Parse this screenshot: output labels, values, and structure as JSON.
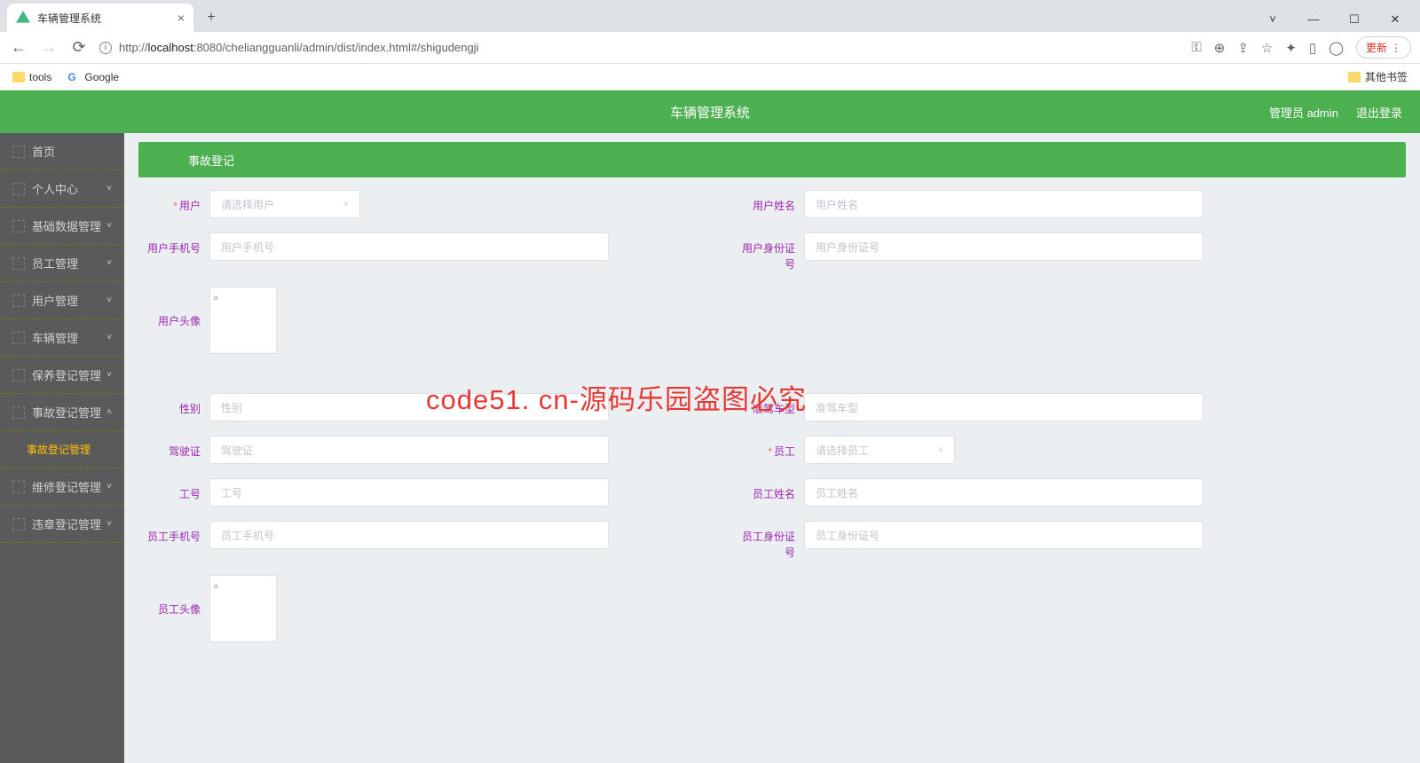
{
  "browser": {
    "tab_title": "车辆管理系统",
    "url_prefix": "http://",
    "url_host": "localhost",
    "url_path": ":8080/cheliangguanli/admin/dist/index.html#/shigudengji",
    "update_label": "更新",
    "bookmarks": {
      "tools": "tools",
      "google": "Google",
      "other": "其他书签"
    }
  },
  "header": {
    "title": "车辆管理系统",
    "admin": "管理员 admin",
    "logout": "退出登录"
  },
  "sidebar": {
    "items": [
      {
        "label": "首页",
        "chev": ""
      },
      {
        "label": "个人中心",
        "chev": "˅"
      },
      {
        "label": "基础数据管理",
        "chev": "˅"
      },
      {
        "label": "员工管理",
        "chev": "˅"
      },
      {
        "label": "用户管理",
        "chev": "˅"
      },
      {
        "label": "车辆管理",
        "chev": "˅"
      },
      {
        "label": "保养登记管理",
        "chev": "˅"
      },
      {
        "label": "事故登记管理",
        "chev": "˄"
      },
      {
        "label": "维修登记管理",
        "chev": "˅"
      },
      {
        "label": "违章登记管理",
        "chev": "˅"
      }
    ],
    "sub_item": "事故登记管理"
  },
  "panel": {
    "title": "事故登记"
  },
  "form": {
    "user": {
      "label": "用户",
      "placeholder": "请选择用户"
    },
    "user_name": {
      "label": "用户姓名",
      "placeholder": "用户姓名"
    },
    "user_phone": {
      "label": "用户手机号",
      "placeholder": "用户手机号"
    },
    "user_idcard": {
      "label": "用户身份证号",
      "placeholder": "用户身份证号"
    },
    "user_avatar": {
      "label": "用户头像"
    },
    "gender": {
      "label": "性别",
      "placeholder": "性别"
    },
    "car_type": {
      "label": "准驾车型",
      "placeholder": "准驾车型"
    },
    "license": {
      "label": "驾驶证",
      "placeholder": "驾驶证"
    },
    "staff": {
      "label": "员工",
      "placeholder": "请选择员工"
    },
    "staff_no": {
      "label": "工号",
      "placeholder": "工号"
    },
    "staff_name": {
      "label": "员工姓名",
      "placeholder": "员工姓名"
    },
    "staff_phone": {
      "label": "员工手机号",
      "placeholder": "员工手机号"
    },
    "staff_idcard": {
      "label": "员工身份证号",
      "placeholder": "员工身份证号"
    },
    "staff_avatar": {
      "label": "员工头像"
    }
  },
  "watermark": "code51. cn-源码乐园盗图必究"
}
